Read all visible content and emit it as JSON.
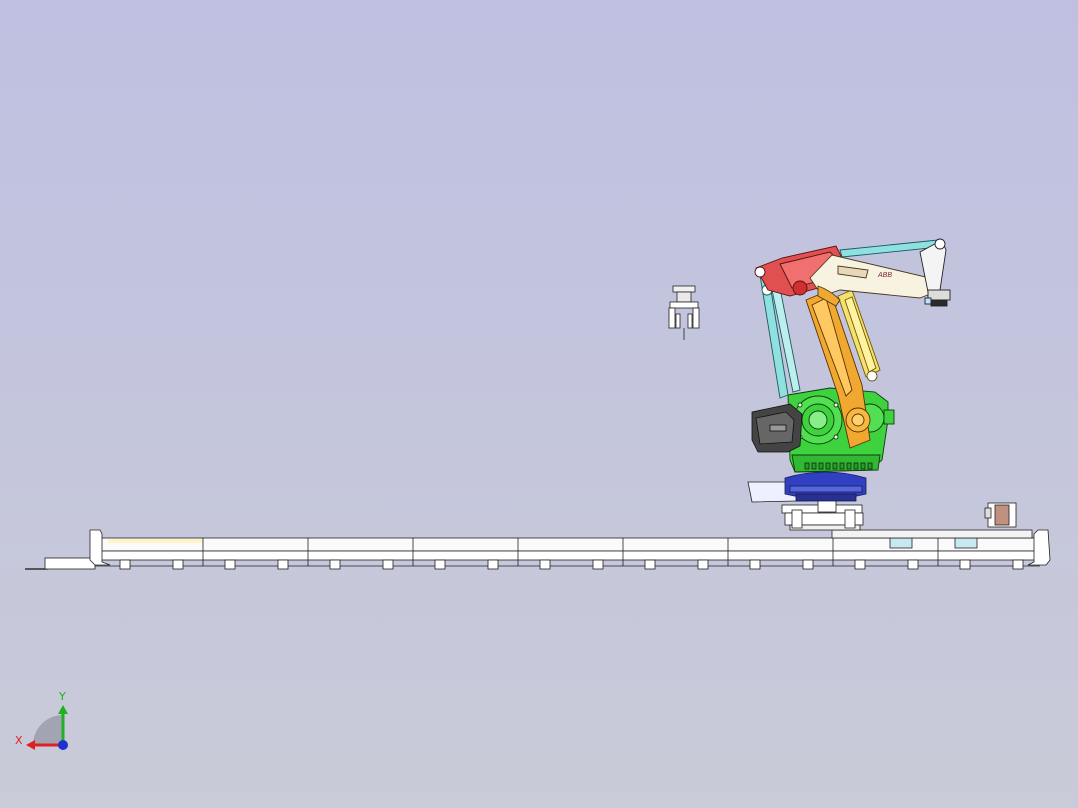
{
  "viewport": {
    "background_top": "#bfc0e1",
    "background_bottom": "#c9cbd8"
  },
  "triad": {
    "x_label": "X",
    "y_label": "Y",
    "x_color": "#e02020",
    "y_color": "#20b020",
    "z_color": "#2030d0"
  },
  "model": {
    "name_plate": "ABB",
    "colors": {
      "base": "#3ed23e",
      "lower_arm": "#f0a830",
      "upper_link": "#e05050",
      "rods": "#8fe0e0",
      "cylinder": "#f5e070",
      "swivel": "#3040c0",
      "rail": "#ffffff",
      "motor": "#555555"
    }
  }
}
